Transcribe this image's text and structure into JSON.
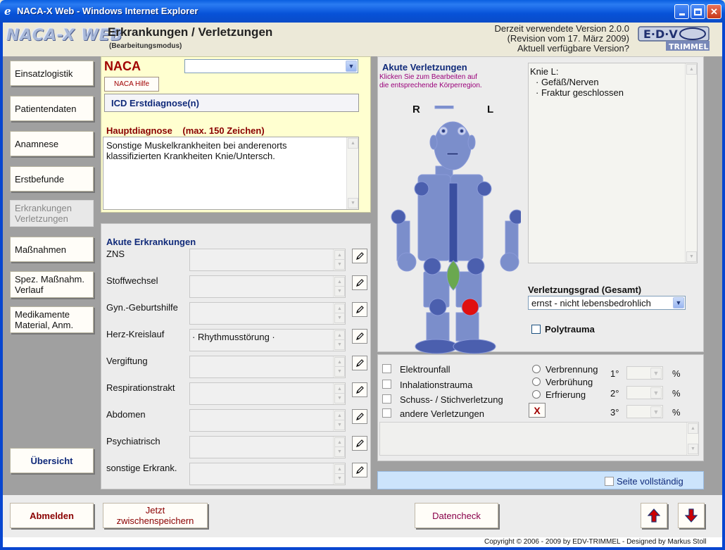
{
  "window": {
    "title": "NACA-X Web - Windows Internet Explorer"
  },
  "header": {
    "logo": "NACA-X WEB",
    "title": "Erkrankungen / Verletzungen",
    "subtitle": "(Bearbeitungsmodus)",
    "version_line1": "Derzeit verwendete Version 2.0.0",
    "version_line2": "(Revision vom 17. März 2009)",
    "version_line3": "Aktuell verfügbare Version?",
    "brand_logo": "EDV TRIMMEL"
  },
  "sidebar": {
    "items": [
      {
        "line1": "Einsatzlogistik",
        "line2": ""
      },
      {
        "line1": "Patientendaten",
        "line2": ""
      },
      {
        "line1": "Anamnese",
        "line2": ""
      },
      {
        "line1": "Erstbefunde",
        "line2": ""
      },
      {
        "line1": "Erkrankungen",
        "line2": "Verletzungen"
      },
      {
        "line1": "Maßnahmen",
        "line2": ""
      },
      {
        "line1": "Spez. Maßnahm.",
        "line2": "Verlauf"
      },
      {
        "line1": "Medikamente",
        "line2": "Material, Anm."
      }
    ],
    "overview": "Übersicht"
  },
  "naca": {
    "label": "NACA",
    "selected": "",
    "help": "NACA Hilfe",
    "icd_button": "ICD Erstdiagnose(n)",
    "hauptdiagnose_label": "Hauptdiagnose",
    "max_chars": "(max. 150 Zeichen)",
    "hauptdiagnose_line1": "Sonstige Muskelkrankheiten bei anderenorts",
    "hauptdiagnose_line2": "klassifizierten Krankheiten  Knie/Untersch."
  },
  "akute_erkrankungen": {
    "title": "Akute Erkrankungen",
    "rows": [
      {
        "label": "ZNS",
        "value": ""
      },
      {
        "label": "Stoffwechsel",
        "value": ""
      },
      {
        "label": "Gyn.-Geburtshilfe",
        "value": ""
      },
      {
        "label": "Herz-Kreislauf",
        "value": "· Rhythmusstörung ·"
      },
      {
        "label": "Vergiftung",
        "value": ""
      },
      {
        "label": "Respirationstrakt",
        "value": ""
      },
      {
        "label": "Abdomen",
        "value": ""
      },
      {
        "label": "Psychiatrisch",
        "value": ""
      },
      {
        "label": "sonstige Erkrank.",
        "value": ""
      }
    ]
  },
  "akute_verletzungen": {
    "title": "Akute Verletzungen",
    "hint_line1": "Klicken Sie zum Bearbeiten auf",
    "hint_line2": "die entsprechende Körperregion.",
    "right": "R",
    "left": "L",
    "text_line1": "Knie L:",
    "text_line2": "· Gefäß/Nerven",
    "text_line3": "· Fraktur geschlossen",
    "grad_label": "Verletzungsgrad (Gesamt)",
    "grad_value": "ernst - nicht lebensbedrohlich",
    "polytrauma": "Polytrauma",
    "colors": {
      "body": "#7b8ecb",
      "joint": "#4b5fae",
      "marker": "#e01010",
      "leaf": "#6aa84f"
    }
  },
  "besondere_verletzungen": {
    "checkboxes": [
      "Elektrounfall",
      "Inhalationstrauma",
      "Schuss- / Stichverletzung",
      "andere Verletzungen"
    ],
    "radios": [
      "Verbrennung",
      "Verbrühung",
      "Erfrierung"
    ],
    "degrees": [
      "1°",
      "2°",
      "3°"
    ],
    "percent": "%",
    "clear": "X"
  },
  "complete": {
    "label": "Seite vollständig"
  },
  "bottom": {
    "logout": "Abmelden",
    "save_line1": "Jetzt",
    "save_line2": "zwischenspeichern",
    "datacheck": "Datencheck"
  },
  "footer": {
    "copyright": "Copyright © 2006 - 2009 by EDV-TRIMMEL - Designed by Markus Stoll"
  }
}
